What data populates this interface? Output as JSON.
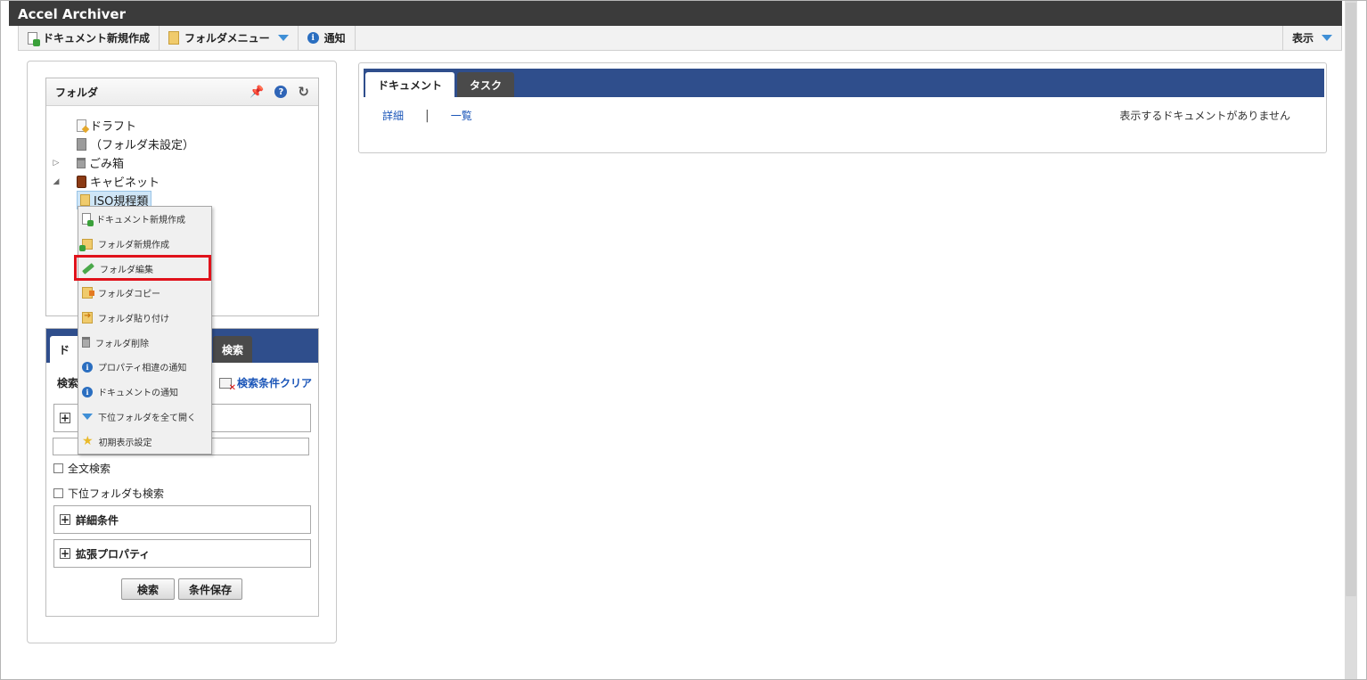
{
  "app": {
    "title": "Accel Archiver"
  },
  "toolbar": {
    "new_document": "ドキュメント新規作成",
    "folder_menu": "フォルダメニュー",
    "notification": "通知",
    "display": "表示"
  },
  "folder_panel": {
    "title": "フォルダ",
    "tree": [
      {
        "label": "ドラフト"
      },
      {
        "label": "（フォルダ未設定）"
      },
      {
        "label": "ごみ箱"
      },
      {
        "label": "キャビネット"
      },
      {
        "label": "ISO規程類"
      }
    ]
  },
  "context_menu": {
    "items": [
      {
        "label": "ドキュメント新規作成",
        "icon": "document-new-icon"
      },
      {
        "label": "フォルダ新規作成",
        "icon": "folder-new-icon"
      },
      {
        "label": "フォルダ編集",
        "icon": "pencil-icon"
      },
      {
        "label": "フォルダコピー",
        "icon": "folder-copy-icon"
      },
      {
        "label": "フォルダ貼り付け",
        "icon": "folder-paste-icon"
      },
      {
        "label": "フォルダ削除",
        "icon": "trash-icon"
      },
      {
        "label": "プロパティ相違の通知",
        "icon": "info-icon"
      },
      {
        "label": "ドキュメントの通知",
        "icon": "info-icon"
      },
      {
        "label": "下位フォルダを全て開く",
        "icon": "expand-down-icon"
      },
      {
        "label": "初期表示設定",
        "icon": "star-icon"
      }
    ],
    "highlight_color": "#e0121b"
  },
  "search_panel": {
    "tab_active_partial": "ド",
    "tab_inactive_partial": "検索",
    "label_partial": "検索",
    "clear_label": "検索条件クリア",
    "fulltext_label": "全文検索",
    "subfolder_label": "下位フォルダも検索",
    "detail_label": "詳細条件",
    "extended_label": "拡張プロパティ",
    "search_button": "検索",
    "save_button": "条件保存"
  },
  "main_panel": {
    "tabs": [
      {
        "label": "ドキュメント",
        "active": true
      },
      {
        "label": "タスク",
        "active": false
      }
    ],
    "view_detail": "詳細",
    "view_list": "一覧",
    "separator": "|",
    "empty_message": "表示するドキュメントがありません"
  },
  "colors": {
    "tab_bar": "#2f4e8c",
    "title_bar": "#3b3b3b",
    "link": "#1a55b8"
  }
}
